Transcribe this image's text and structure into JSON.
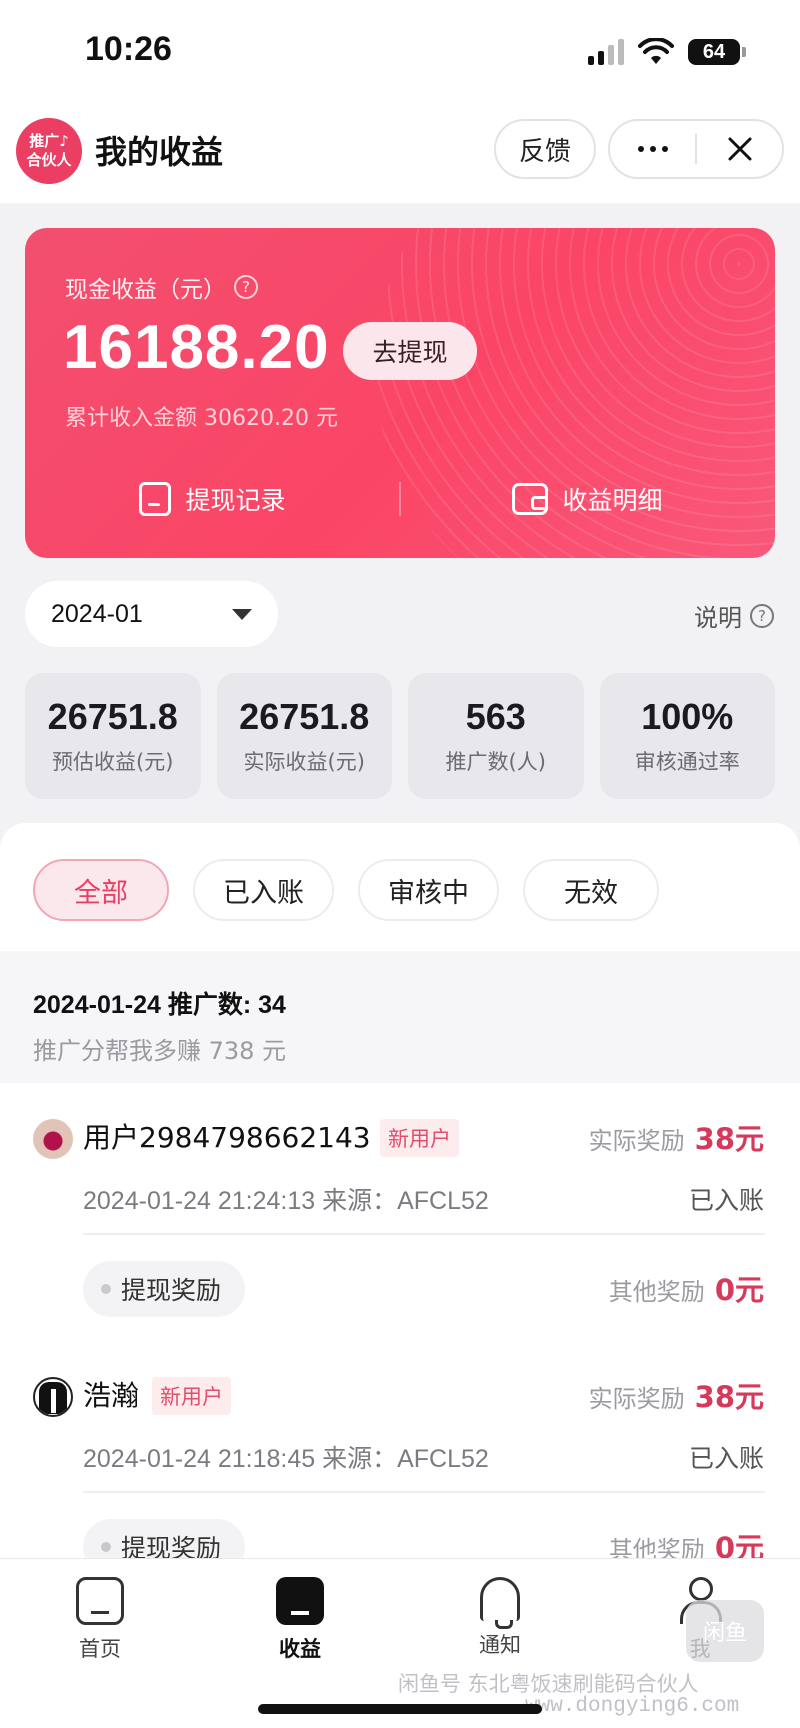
{
  "status_bar": {
    "time": "10:26",
    "battery": "64"
  },
  "header": {
    "logo_line1": "推广♪",
    "logo_line2": "合伙人",
    "title": "我的收益",
    "feedback": "反馈"
  },
  "earnings": {
    "cash_label": "现金收益（元）",
    "amount": "16188.20",
    "withdraw_button": "去提现",
    "total_income": "累计收入金额 30620.20 元",
    "link_withdraw_records": "提现记录",
    "link_income_detail": "收益明细"
  },
  "filter": {
    "month": "2024-01",
    "explain": "说明"
  },
  "stats": [
    {
      "value": "26751.8",
      "label": "预估收益(元)"
    },
    {
      "value": "26751.8",
      "label": "实际收益(元)"
    },
    {
      "value": "563",
      "label": "推广数(人)"
    },
    {
      "value": "100%",
      "label": "审核通过率"
    }
  ],
  "tabs": [
    "全部",
    "已入账",
    "审核中",
    "无效"
  ],
  "day": {
    "title": "2024-01-24 推广数: 34",
    "subtitle": "推广分帮我多赚 738 元"
  },
  "records": [
    {
      "user": "用户2984798662143",
      "badge": "新用户",
      "actual_label": "实际奖励",
      "actual_value": "38元",
      "meta": "2024-01-24 21:24:13 来源：AFCL52",
      "state": "已入账",
      "chip": "提现奖励",
      "other_label": "其他奖励",
      "other_value": "0元"
    },
    {
      "user": "浩瀚",
      "badge": "新用户",
      "actual_label": "实际奖励",
      "actual_value": "38元",
      "meta": "2024-01-24 21:18:45 来源：AFCL52",
      "state": "已入账",
      "chip": "提现奖励",
      "other_label": "其他奖励",
      "other_value": "0元"
    }
  ],
  "nav": [
    "首页",
    "收益",
    "通知",
    "我"
  ],
  "watermark": {
    "badge": "闲鱼",
    "text": "闲鱼号  东北粤饭速刷能码合伙人",
    "url": "www.dongying6.com"
  }
}
